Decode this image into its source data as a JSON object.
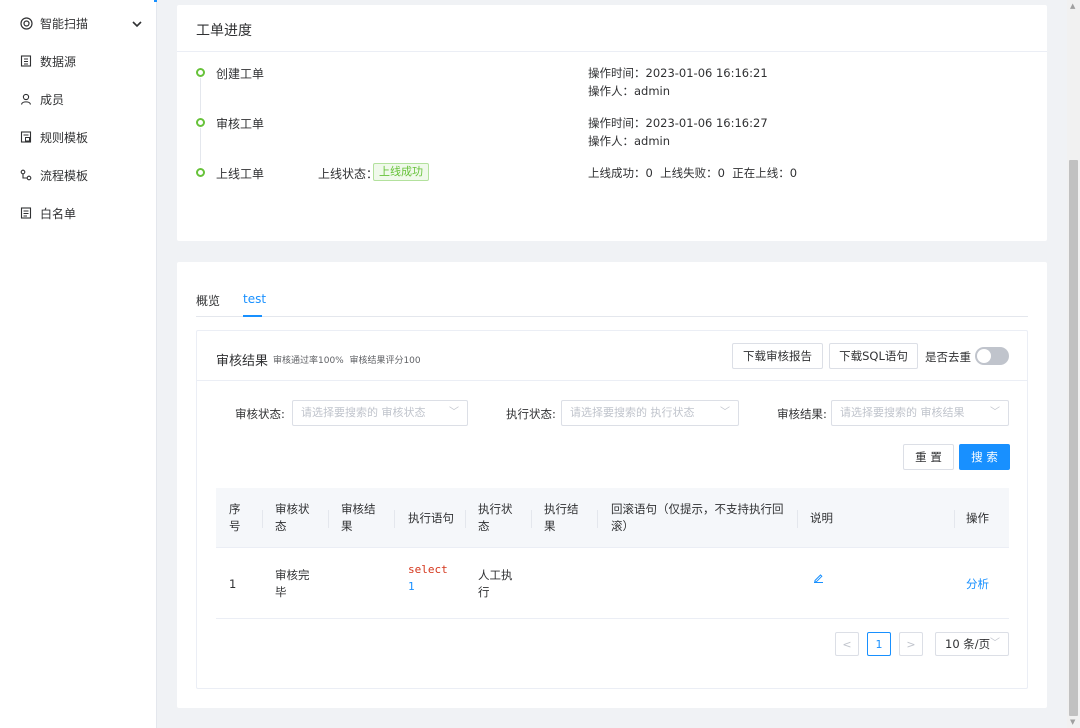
{
  "sidebar": {
    "items": [
      {
        "label": "智能扫描",
        "icon": "target-icon"
      },
      {
        "label": "数据源",
        "icon": "database-icon"
      },
      {
        "label": "成员",
        "icon": "user-icon"
      },
      {
        "label": "规则模板",
        "icon": "rule-template-icon"
      },
      {
        "label": "流程模板",
        "icon": "workflow-icon"
      },
      {
        "label": "白名单",
        "icon": "whitelist-icon"
      }
    ]
  },
  "progress": {
    "title": "工单进度",
    "steps": [
      {
        "name": "创建工单",
        "time": "操作时间：2023-01-06 16:16:21",
        "operator": "操作人：admin"
      },
      {
        "name": "审核工单",
        "time": "操作时间：2023-01-06 16:16:27",
        "operator": "操作人：admin"
      },
      {
        "name": "上线工单",
        "status_label": "上线状态：",
        "status_tag": "上线成功",
        "summary": "上线成功：0  上线失败：0  正在上线：0"
      }
    ]
  },
  "tabs": [
    "概览",
    "test"
  ],
  "audit": {
    "title": "审核结果",
    "subtitle": "审核通过率100%  审核结果评分100",
    "download_report": "下载审核报告",
    "download_sql": "下载SQL语句",
    "dedupe_label": "是否去重",
    "dedupe_on": false
  },
  "filters": {
    "audit_status_label": "审核状态:",
    "audit_status_placeholder": "请选择要搜索的 审核状态",
    "exec_status_label": "执行状态:",
    "exec_status_placeholder": "请选择要搜索的 执行状态",
    "audit_result_label": "审核结果:",
    "audit_result_placeholder": "请选择要搜索的 审核结果",
    "reset": "重 置",
    "search": "搜 索"
  },
  "table": {
    "headers": [
      "序号",
      "审核状态",
      "审核结果",
      "执行语句",
      "执行状态",
      "执行结果",
      "回滚语句（仅提示，不支持执行回滚）",
      "说明",
      "操作"
    ],
    "rows": [
      {
        "index": "1",
        "audit_status": "审核完毕",
        "audit_result": "",
        "sql_kw": "select",
        "sql_num": "1",
        "exec_status": "人工执行",
        "exec_result": "",
        "rollback": "",
        "action": "分析"
      }
    ]
  },
  "pagination": {
    "current": "1",
    "page_size": "10 条/页"
  }
}
